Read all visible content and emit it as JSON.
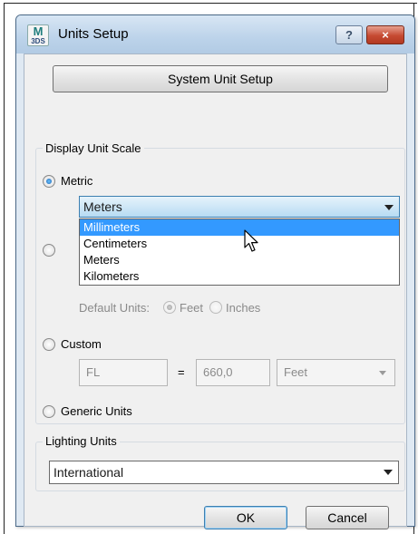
{
  "window": {
    "title": "Units Setup",
    "app_icon_letter": "M",
    "app_icon_sub": "3DS",
    "help_label": "?",
    "close_label": "×"
  },
  "system_unit_button": "System Unit Setup",
  "display_unit_scale": {
    "group_label": "Display Unit Scale",
    "metric_label": "Metric",
    "metric_selected": "Meters",
    "metric_options": [
      "Millimeters",
      "Centimeters",
      "Meters",
      "Kilometers"
    ],
    "highlighted_option": "Millimeters",
    "default_units_label": "Default Units:",
    "feet_label": "Feet",
    "inches_label": "Inches",
    "custom_label": "Custom",
    "custom_name": "FL",
    "equals": "=",
    "custom_value": "660,0",
    "custom_unit": "Feet",
    "generic_label": "Generic Units"
  },
  "lighting_units": {
    "group_label": "Lighting Units",
    "selected": "International"
  },
  "buttons": {
    "ok": "OK",
    "cancel": "Cancel"
  },
  "colors": {
    "highlight": "#3399ff",
    "title_gradient_top": "#d8e6f4",
    "close_button": "#c64a32"
  }
}
